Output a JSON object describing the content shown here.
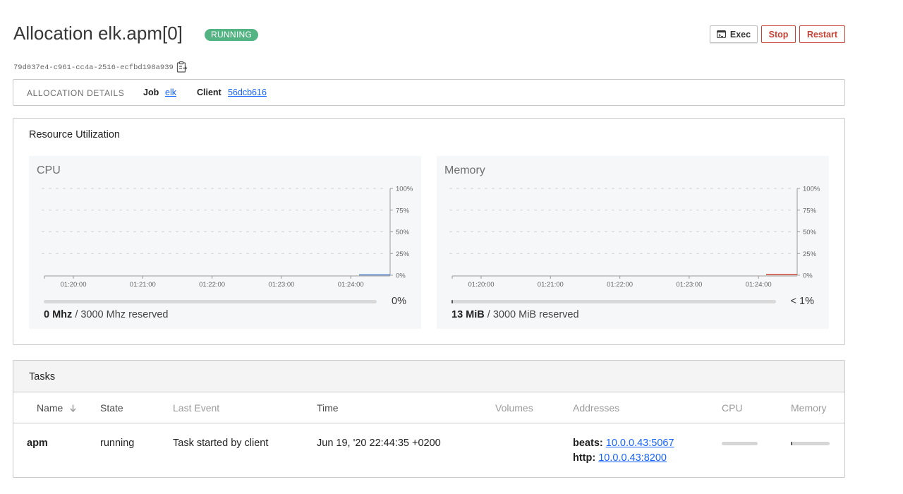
{
  "header": {
    "title": "Allocation elk.apm[0]",
    "status": "RUNNING",
    "exec_label": "Exec",
    "stop_label": "Stop",
    "restart_label": "Restart",
    "allocation_id": "79d037e4-c961-cc4a-2516-ecfbd198a939"
  },
  "details": {
    "heading": "ALLOCATION DETAILS",
    "job_label": "Job",
    "job_value": "elk",
    "client_label": "Client",
    "client_value": "56dcb616"
  },
  "resources": {
    "heading": "Resource Utilization",
    "cpu": {
      "title": "CPU",
      "percent_label": "0%",
      "used": "0 Mhz",
      "reserved": "/ 3000 Mhz reserved",
      "usage_fraction": 0.0,
      "series_color": "#4a7cc7",
      "y_ticks": [
        "100%",
        "75%",
        "50%",
        "25%",
        "0%"
      ],
      "x_ticks": [
        "01:20:00",
        "01:21:00",
        "01:22:00",
        "01:23:00",
        "01:24:00"
      ]
    },
    "memory": {
      "title": "Memory",
      "percent_label": "< 1%",
      "used": "13 MiB",
      "reserved": "/ 3000 MiB reserved",
      "usage_fraction": 0.004,
      "series_color": "#c84034",
      "y_ticks": [
        "100%",
        "75%",
        "50%",
        "25%",
        "0%"
      ],
      "x_ticks": [
        "01:20:00",
        "01:21:00",
        "01:22:00",
        "01:23:00",
        "01:24:00"
      ]
    }
  },
  "tasks": {
    "heading": "Tasks",
    "columns": {
      "name": "Name",
      "state": "State",
      "last_event": "Last Event",
      "time": "Time",
      "volumes": "Volumes",
      "addresses": "Addresses",
      "cpu": "CPU",
      "memory": "Memory"
    },
    "rows": [
      {
        "name": "apm",
        "state": "running",
        "last_event": "Task started by client",
        "time": "Jun 19, '20 22:44:35 +0200",
        "volumes": "",
        "address_1_label": "beats:",
        "address_1_value": "10.0.0.43:5067",
        "address_2_label": "http:",
        "address_2_value": "10.0.0.43:8200",
        "cpu_fraction": 0.0,
        "memory_fraction": 0.004
      }
    ]
  },
  "colors": {
    "running_badge": "#54b383",
    "danger": "#c84034",
    "link": "#1563ff"
  }
}
